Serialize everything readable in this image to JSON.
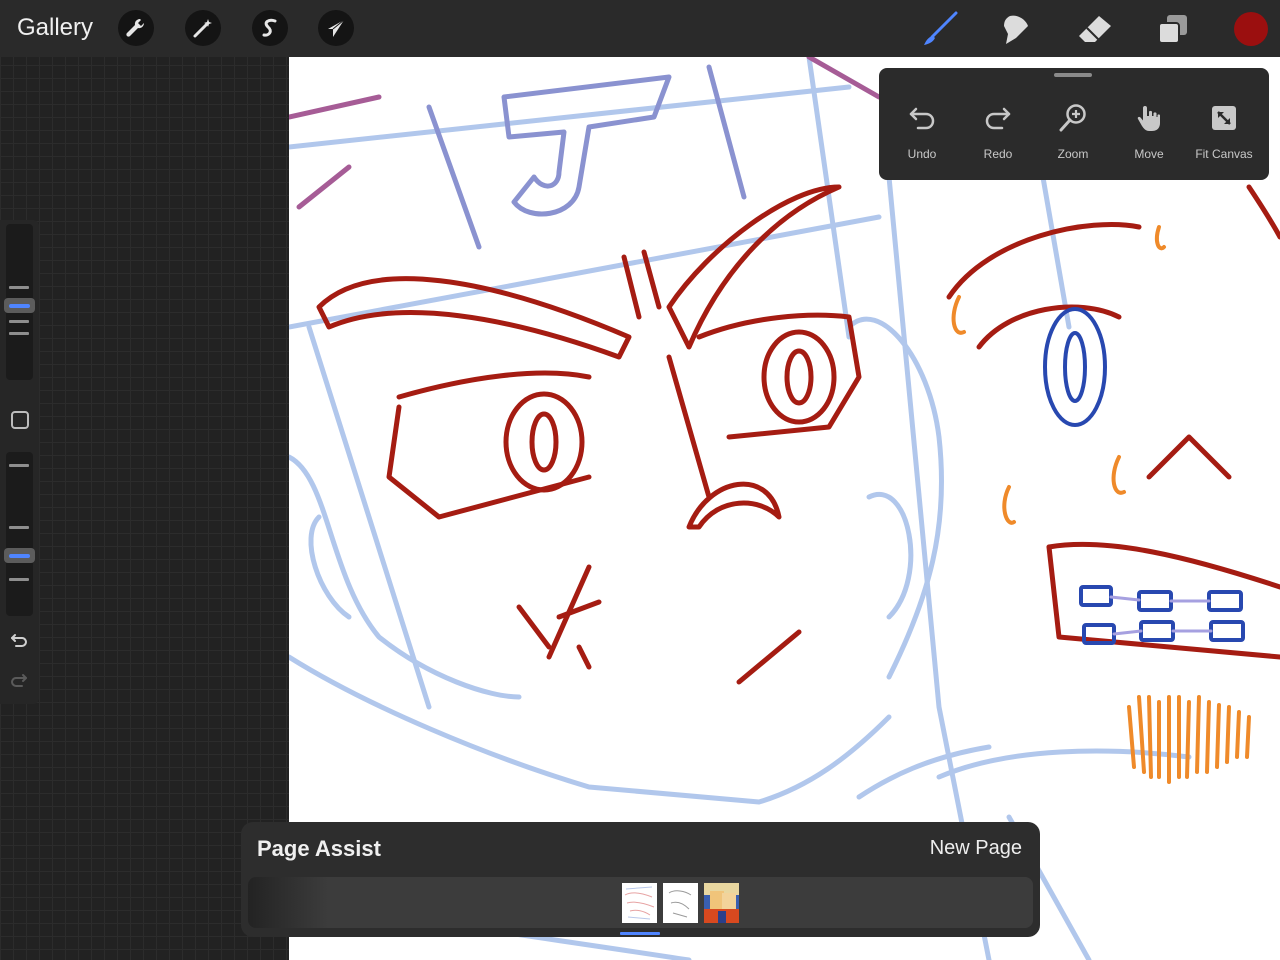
{
  "topbar": {
    "gallery_label": "Gallery",
    "left_tools": [
      {
        "icon": "wrench-icon"
      },
      {
        "icon": "magic-wand-icon"
      },
      {
        "icon": "selection-s-icon"
      },
      {
        "icon": "arrow-cursor-icon"
      }
    ],
    "right_tools": [
      {
        "icon": "brush-icon",
        "active": true
      },
      {
        "icon": "smudge-icon"
      },
      {
        "icon": "eraser-icon"
      },
      {
        "icon": "layers-icon"
      }
    ],
    "current_color": "#9b0f0f"
  },
  "sidebar": {
    "brush_size_level": 0.4,
    "opacity_level": 0.65,
    "undo_icon": "undo-icon",
    "redo_icon": "redo-icon"
  },
  "quick_menu": {
    "items": [
      {
        "label": "Undo",
        "icon": "undo-icon"
      },
      {
        "label": "Redo",
        "icon": "redo-icon"
      },
      {
        "label": "Zoom",
        "icon": "zoom-icon"
      },
      {
        "label": "Move",
        "icon": "hand-icon"
      },
      {
        "label": "Fit Canvas",
        "icon": "fit-canvas-icon"
      }
    ]
  },
  "page_assist": {
    "title": "Page Assist",
    "new_page_label": "New Page",
    "pages": [
      {
        "name": "page-1",
        "selected": true
      },
      {
        "name": "page-2",
        "selected": false
      },
      {
        "name": "page-3",
        "selected": false
      }
    ]
  },
  "colors": {
    "accent": "#4f85ff",
    "sketch_red": "#a51c12",
    "sketch_blue": "#9fbbe8",
    "sketch_dark_blue": "#2848b0",
    "sketch_orange": "#ef8a2a"
  }
}
